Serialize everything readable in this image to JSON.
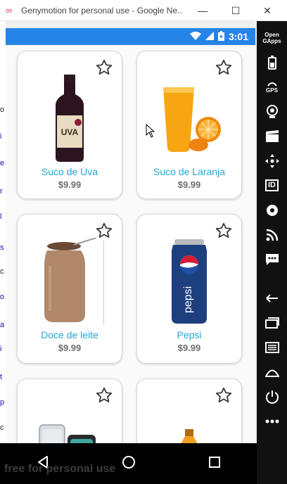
{
  "window": {
    "title": "Genymotion for personal use - Google Ne...",
    "minimize": "—",
    "maximize": "☐",
    "close": "✕"
  },
  "status_bar": {
    "time": "3:01"
  },
  "products": [
    {
      "name": "Suco de Uva",
      "price": "$9.99",
      "image_label": "UVA"
    },
    {
      "name": "Suco de Laranja",
      "price": "$9.99"
    },
    {
      "name": "Doce de leite",
      "price": "$9.99"
    },
    {
      "name": "Pepsi",
      "price": "$9.99",
      "image_label": "pepsi"
    },
    {
      "name": "",
      "price": ""
    },
    {
      "name": "",
      "price": ""
    }
  ],
  "sidebar": {
    "items": [
      {
        "label": "Open GApps",
        "icon": "open-gapps-icon"
      },
      {
        "label": "",
        "icon": "battery-icon"
      },
      {
        "label": "GPS",
        "icon": "gps-icon"
      },
      {
        "label": "",
        "icon": "webcam-icon"
      },
      {
        "label": "",
        "icon": "screencast-icon"
      },
      {
        "label": "",
        "icon": "dpad-icon"
      },
      {
        "label": "ID",
        "icon": "identifiers-icon"
      },
      {
        "label": "",
        "icon": "disk-icon"
      },
      {
        "label": "",
        "icon": "network-icon"
      },
      {
        "label": "",
        "icon": "sms-icon"
      },
      {
        "label": "",
        "icon": "back-icon"
      },
      {
        "label": "",
        "icon": "recent-apps-icon"
      },
      {
        "label": "",
        "icon": "menu-icon"
      },
      {
        "label": "",
        "icon": "home-icon"
      },
      {
        "label": "",
        "icon": "power-icon"
      },
      {
        "label": "",
        "icon": "more-icon"
      }
    ]
  },
  "watermark": "free for personal use",
  "colors": {
    "status_bar": "#2684e8",
    "product_name": "#2aa3d6",
    "price": "#6e6e6e"
  }
}
